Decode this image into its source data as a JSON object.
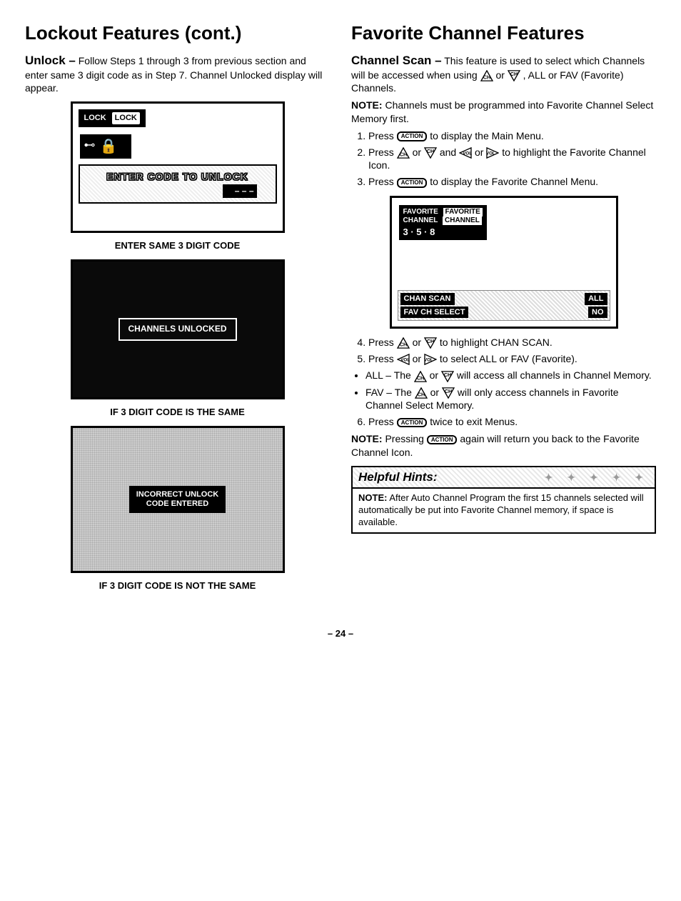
{
  "left": {
    "heading": "Lockout Features (cont.)",
    "unlock_label": "Unlock –",
    "unlock_text": "Follow Steps 1 through 3 from previous section and enter same 3 digit code as in Step 7. Channel Unlocked display will appear.",
    "screen1": {
      "lock_label": "LOCK",
      "lock_inv": "LOCK",
      "enter_code": "ENTER  CODE  TO  UNLOCK",
      "dashes": "– – –"
    },
    "caption1": "ENTER SAME 3 DIGIT CODE",
    "screen2_msg": "CHANNELS UNLOCKED",
    "caption2": "IF 3 DIGIT CODE IS THE SAME",
    "screen3_line1": "INCORRECT UNLOCK",
    "screen3_line2": "CODE ENTERED",
    "caption3": "IF 3 DIGIT CODE IS NOT THE SAME"
  },
  "right": {
    "heading": "Favorite Channel Features",
    "chscan_label": "Channel Scan –",
    "chscan_text_a": "This feature is used to select which Channels will be accessed when using",
    "chscan_text_b": "or",
    "chscan_text_c": ", ALL or FAV (Favorite) Channels.",
    "note1_label": "NOTE:",
    "note1_text": "Channels must be programmed into Favorite Channel Select Memory first.",
    "step1_a": "Press",
    "step1_b": "to display the Main Menu.",
    "step2_a": "Press",
    "step2_b": "or",
    "step2_c": "and",
    "step2_d": "or",
    "step2_e": "to highlight the Favorite Channel Icon.",
    "step3_a": "Press",
    "step3_b": "to display the Favorite Channel Menu.",
    "fav_screen": {
      "top_label1": "FAVORITE",
      "top_label2": "CHANNEL",
      "top_inv1": "FAVORITE",
      "top_inv2": "CHANNEL",
      "nums": "3 · 5 · 8",
      "row1_l": "CHAN SCAN",
      "row1_r": "ALL",
      "row2_l": "FAV CH SELECT",
      "row2_r": "NO"
    },
    "step4_a": "Press",
    "step4_b": "or",
    "step4_c": "to highlight CHAN SCAN.",
    "step5_a": "Press",
    "step5_b": "or",
    "step5_c": "to select ALL or FAV (Favorite).",
    "bullet_all_a": "ALL – The",
    "bullet_all_b": "or",
    "bullet_all_c": "will access all channels in Channel Memory.",
    "bullet_fav_a": "FAV – The",
    "bullet_fav_b": "or",
    "bullet_fav_c": "will only access channels in Favorite Channel Select Memory.",
    "step6_a": "Press",
    "step6_b": "twice to exit Menus.",
    "note2_label": "NOTE:",
    "note2_a": "Pressing",
    "note2_b": "again will return you back to the Favorite Channel Icon.",
    "hints_header": "Helpful Hints:",
    "hints_note_label": "NOTE:",
    "hints_note_text": "After Auto Channel Program the first 15 channels selected will automatically be put into Favorite Channel memory, if space is available."
  },
  "action_label": "ACTION",
  "page_number": "– 24 –"
}
